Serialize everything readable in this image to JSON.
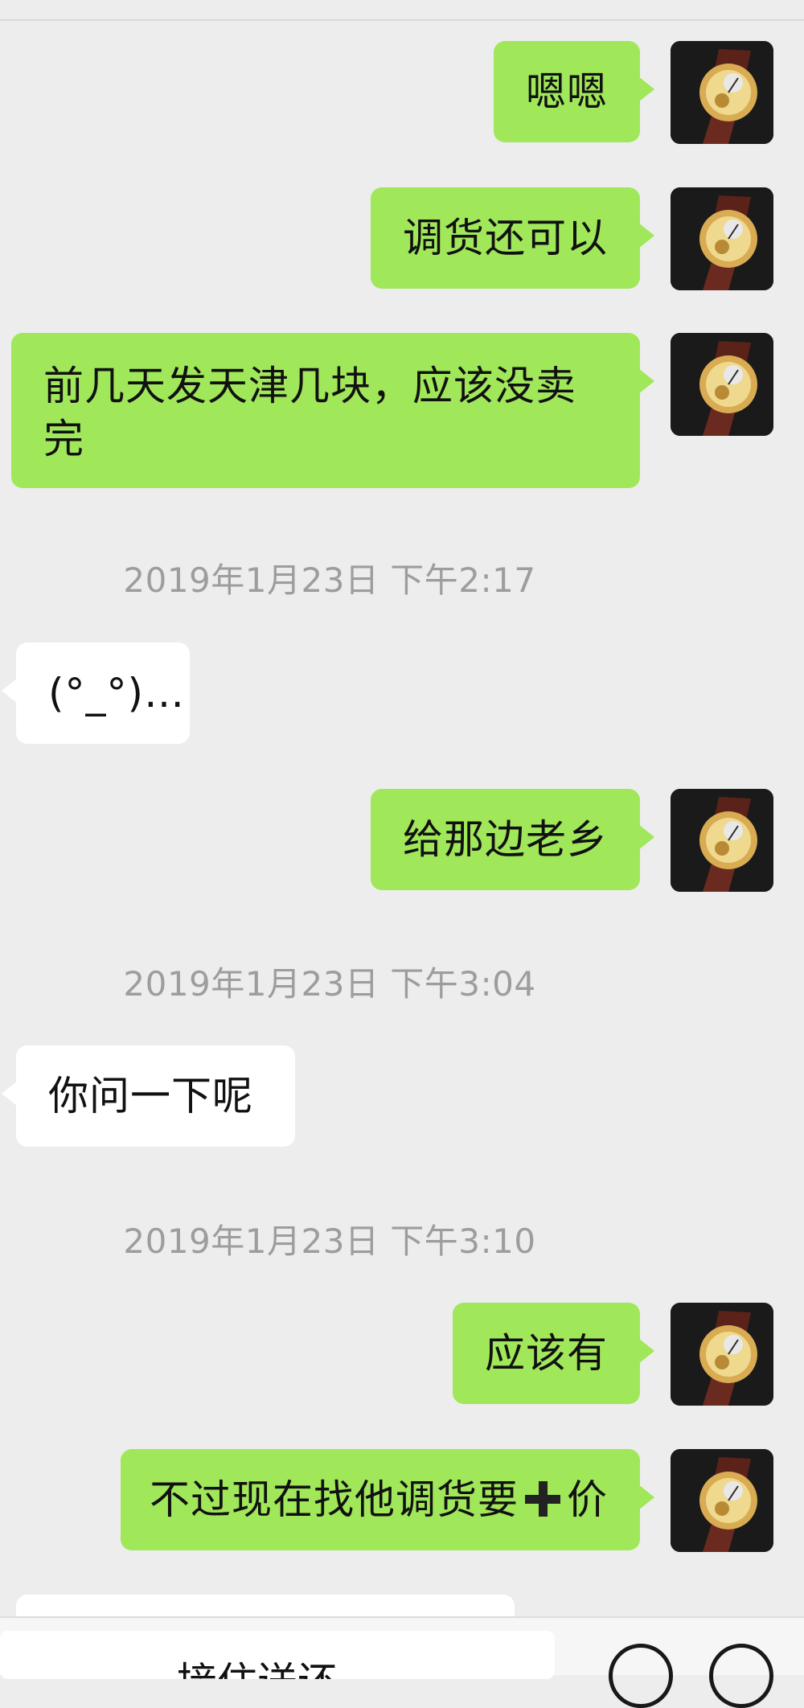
{
  "colors": {
    "page_bg": "#ededed",
    "outgoing_bubble": "#a0e75a",
    "incoming_bubble": "#ffffff",
    "timestamp": "#9d9d9d"
  },
  "messages": {
    "m1": "嗯嗯",
    "m2": "调货还可以",
    "m3_line1": "前几天发天津几块，应该没卖",
    "m3_line2": "完",
    "ts1": "2019年1月23日 下午2:17",
    "m4": "(°_°)…",
    "m5": "给那边老乡",
    "ts2": "2019年1月23日 下午3:04",
    "m6": "你问一下呢",
    "ts3": "2019年1月23日 下午3:10",
    "m7": "应该有",
    "m8_before": "不过现在找他调货要",
    "m8_icon": "plus-icon",
    "m8_after": "价"
  },
  "input_bar": {
    "text": "接住送还",
    "icons": [
      "emoji-icon",
      "add-icon"
    ]
  },
  "avatar_icon": "watch-avatar-icon"
}
